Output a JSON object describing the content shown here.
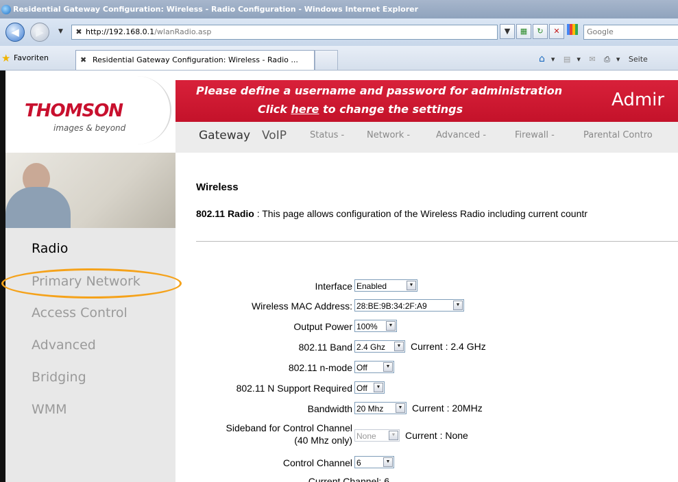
{
  "browser": {
    "title": "Residential Gateway Configuration: Wireless - Radio Configuration - Windows Internet Explorer",
    "url_host": "http://192.168.0.1",
    "url_path": "/wlanRadio.asp",
    "search_placeholder": "Google",
    "favorites_label": "Favoriten",
    "tab_title": "Residential Gateway Configuration: Wireless - Radio ...",
    "cmd_page": "Seite"
  },
  "header": {
    "brand": "THOMSON",
    "tagline": "images & beyond",
    "banner_line1": "Please define a username and password for administration",
    "banner_line2_pre": "Click ",
    "banner_line2_link": "here",
    "banner_line2_post": " to change the settings",
    "banner_right": "Admir"
  },
  "topnav": {
    "items": [
      "Gateway",
      "VoIP",
      "Status -",
      "Network -",
      "Advanced -",
      "Firewall -",
      "Parental Contro"
    ]
  },
  "sidebar": {
    "items": [
      "Radio",
      "Primary Network",
      "Access Control",
      "Advanced",
      "Bridging",
      "WMM"
    ],
    "active": "Radio",
    "highlighted": "Primary Network"
  },
  "main": {
    "heading": "Wireless",
    "desc_bold": "802.11 Radio",
    "desc_text": " :  This page allows configuration of the Wireless Radio including current countr",
    "fields": [
      {
        "label": "Interface",
        "value": "Enabled",
        "current": ""
      },
      {
        "label": "Wireless MAC Address:",
        "value": "28:BE:9B:34:2F:A9",
        "current": ""
      },
      {
        "label": "Output Power",
        "value": "100%",
        "current": ""
      },
      {
        "label": "802.11 Band",
        "value": "2.4 Ghz",
        "current": "Current :  2.4 GHz"
      },
      {
        "label": "802.11 n-mode",
        "value": "Off",
        "current": ""
      },
      {
        "label": "802.11 N Support Required",
        "value": "Off",
        "current": ""
      },
      {
        "label": "Bandwidth",
        "value": "20 Mhz",
        "current": "Current :  20MHz"
      },
      {
        "label": "Sideband for Control Channel",
        "label2": "(40 Mhz only)",
        "value": "None",
        "current": "Current : None",
        "disabled": true
      },
      {
        "label": "Control Channel",
        "value": "6",
        "current": ""
      },
      {
        "label": "Current Channel: 6",
        "value": "",
        "current": ""
      }
    ]
  },
  "colors": {
    "accent_red": "#c4122a",
    "highlight_orange": "#f5a21a",
    "sidebar_bg": "#e8e8e8"
  }
}
